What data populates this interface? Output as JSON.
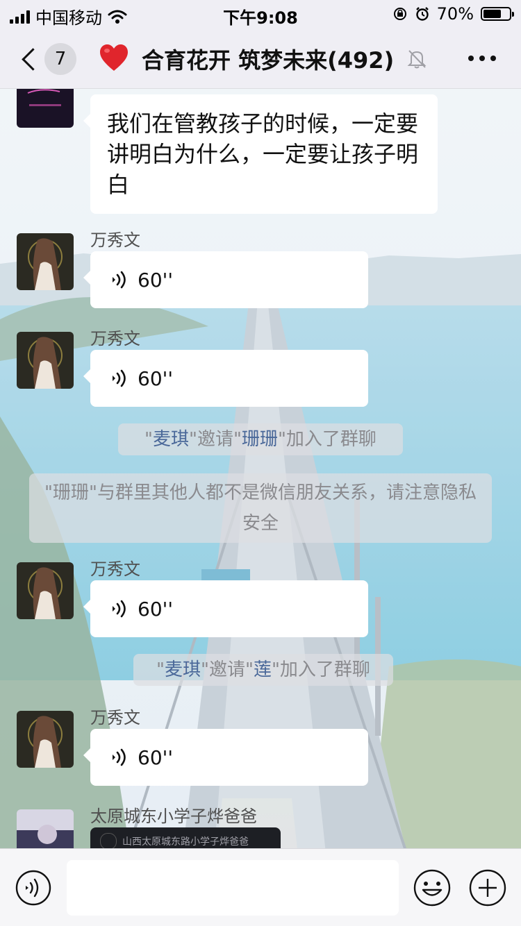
{
  "status_bar": {
    "carrier": "中国移动",
    "time": "下午9:08",
    "battery": "70%",
    "battery_level": 0.7
  },
  "nav": {
    "unread_count": "7",
    "title": "合育花开 筑梦未来(492)",
    "icons": {
      "back": "back-chevron-icon",
      "heart": "heart-icon",
      "mute": "mute-bell-icon",
      "more": "more-dots-icon"
    }
  },
  "messages": [
    {
      "type": "text",
      "text": "我们在管教孩子的时候，一定要讲明白为什么，一定要让孩子明白"
    },
    {
      "type": "voice",
      "sender": "万秀文",
      "duration": "60''"
    },
    {
      "type": "voice",
      "sender": "万秀文",
      "duration": "60''"
    },
    {
      "type": "system",
      "parts": [
        "\"",
        "麦琪",
        "\"邀请\"",
        "珊珊",
        "\"加入了群聊"
      ]
    },
    {
      "type": "system",
      "text": "\"珊珊\"与群里其他人都不是微信朋友关系，请注意隐私安全"
    },
    {
      "type": "voice",
      "sender": "万秀文",
      "duration": "60''"
    },
    {
      "type": "system",
      "parts": [
        "\"",
        "麦琪",
        "\"邀请\"",
        "莲",
        "\"加入了群聊"
      ]
    },
    {
      "type": "voice",
      "sender": "万秀文",
      "duration": "60''"
    },
    {
      "type": "card",
      "sender": "太原城东小学子烨爸爸",
      "card_text": "山西太原城东路小学子烨爸爸"
    }
  ],
  "input_bar": {
    "placeholder": "",
    "icons": {
      "voice": "voice-mode-icon",
      "emoji": "emoji-smile-icon",
      "plus": "plus-circle-icon"
    }
  },
  "colors": {
    "bubble": "#ffffff",
    "system_name": "#4a6899",
    "system_text": "#8a8a8e",
    "bar_bg": "#efeef4"
  }
}
